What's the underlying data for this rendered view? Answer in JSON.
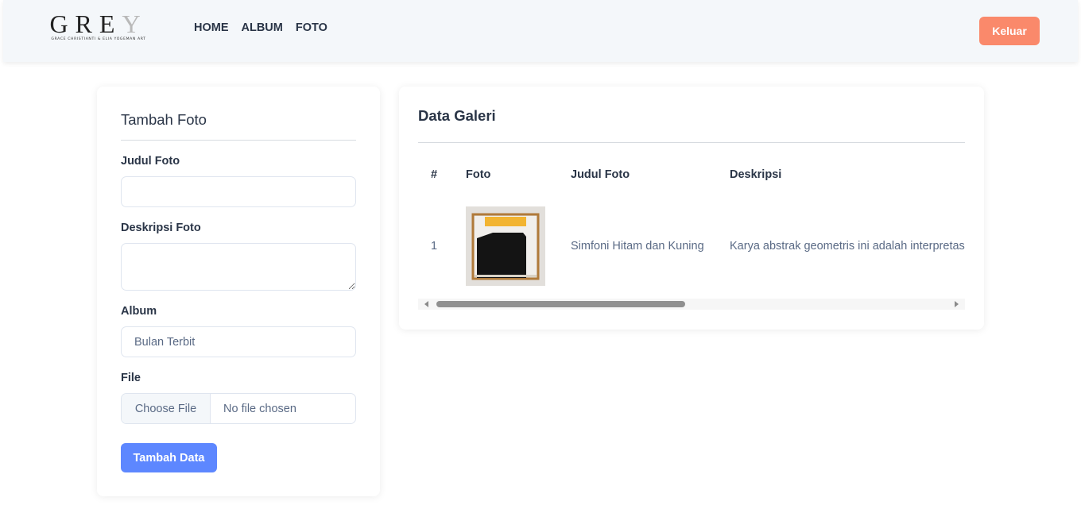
{
  "brand": {
    "logo_main": "GRE",
    "logo_last": "Y",
    "logo_sub": "GRACE CHRISTIANTI & ELIA YOGEMAN ART"
  },
  "nav": {
    "items": [
      {
        "label": "HOME"
      },
      {
        "label": "ALBUM"
      },
      {
        "label": "FOTO"
      }
    ],
    "logout_label": "Keluar"
  },
  "form": {
    "title": "Tambah Foto",
    "judul_label": "Judul Foto",
    "judul_value": "",
    "deskripsi_label": "Deskripsi Foto",
    "deskripsi_value": "",
    "album_label": "Album",
    "album_selected": "Bulan Terbit",
    "file_label": "File",
    "file_button": "Choose File",
    "file_status": "No file chosen",
    "submit_label": "Tambah Data"
  },
  "gallery": {
    "title": "Data Galeri",
    "columns": [
      "#",
      "Foto",
      "Judul Foto",
      "Deskripsi"
    ],
    "rows": [
      {
        "no": "1",
        "judul": "Simfoni Hitam dan Kuning",
        "deskripsi": "Karya abstrak geometris ini adalah interpretasi"
      }
    ]
  },
  "colors": {
    "accent": "#5d87ff",
    "danger": "#fa896b",
    "header_bg": "#f4f7fa"
  }
}
